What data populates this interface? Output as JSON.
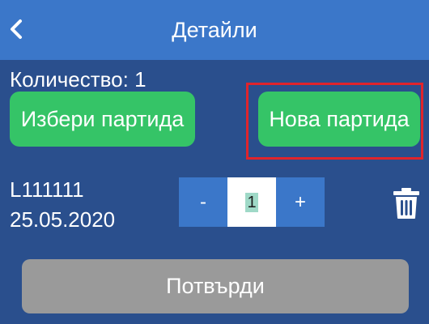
{
  "header": {
    "title": "Детайли",
    "back_icon": "chevron-left-icon"
  },
  "details": {
    "quantity_label": "Количество: 1"
  },
  "actions": {
    "select_batch_label": "Избери партида",
    "new_batch_label": "Нова партида"
  },
  "batch": {
    "code": "L111111",
    "date": "25.05.2020",
    "stepper": {
      "minus_label": "-",
      "value": "1",
      "plus_label": "+"
    },
    "delete_icon": "trash-icon"
  },
  "footer": {
    "confirm_label": "Потвърди"
  },
  "colors": {
    "background": "#2a4f8d",
    "header": "#3b77c9",
    "green": "#35c467",
    "highlight": "#e0242c",
    "disabled": "#9a9a9a"
  }
}
